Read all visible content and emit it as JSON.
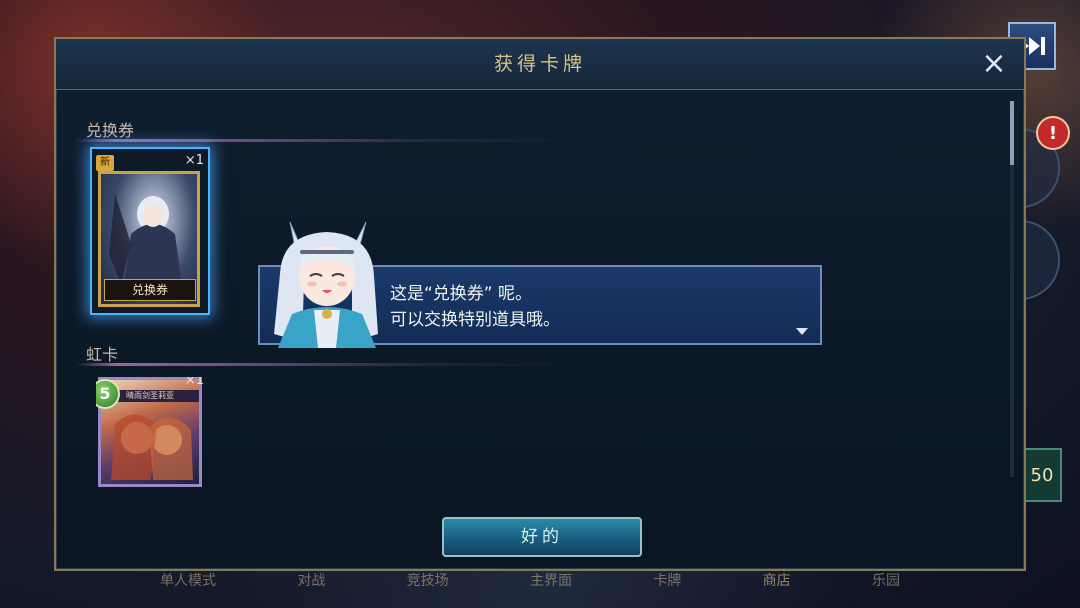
{
  "modal": {
    "title": "获得卡牌",
    "close_label": "×"
  },
  "sections": [
    {
      "label": "兑换券",
      "card": {
        "name": "兑换券",
        "badge": "新",
        "quantity": "×1"
      }
    },
    {
      "label": "虹卡",
      "card": {
        "cost": "5",
        "strip_text": "晴雨剑圣莉亚",
        "quantity": "×1"
      }
    }
  ],
  "dialogue": {
    "line1": "这是“兑换券” 呢。",
    "line2": "可以交换特别道具哦。"
  },
  "ok_button": {
    "label": "好的"
  },
  "bottom_nav": [
    "单人模式",
    "对战",
    "竞技场",
    "主界面",
    "卡牌",
    "商店",
    "乐园"
  ],
  "side": {
    "alert": "!",
    "count": "50"
  },
  "colors": {
    "accent_gold": "#d8c08a",
    "selection_glow": "#4fb4ff",
    "dialogue_bg": "#1a3a6a"
  },
  "icons": [
    "skip-forward-icon",
    "close-icon",
    "next-arrow-icon",
    "new-badge",
    "cost-gem"
  ]
}
